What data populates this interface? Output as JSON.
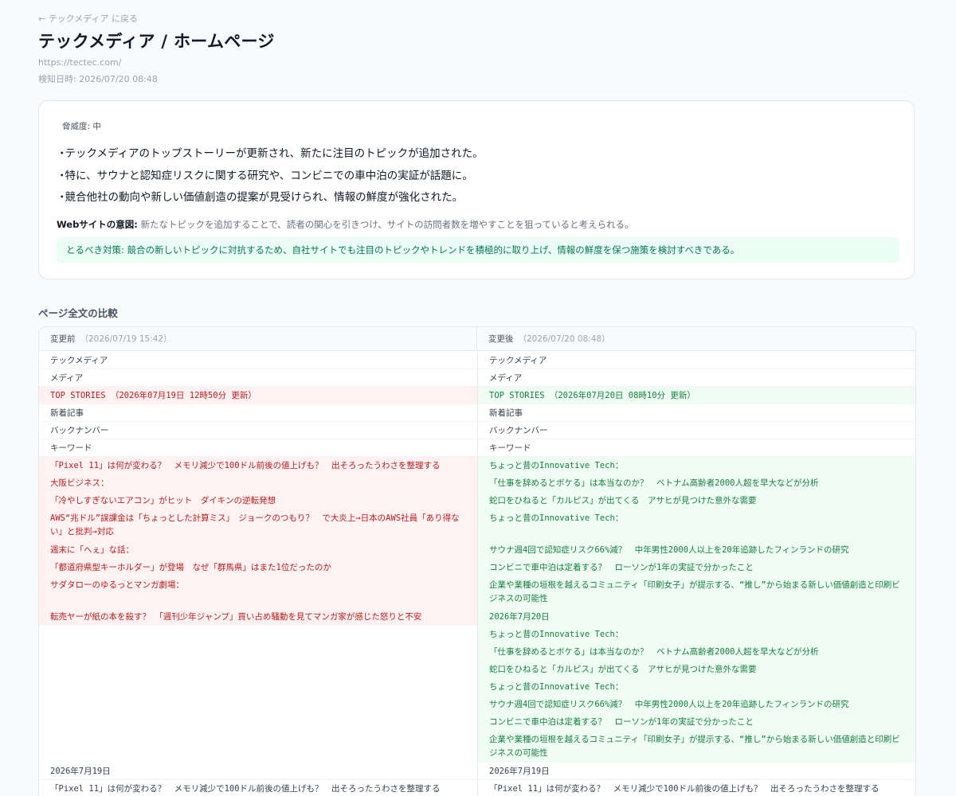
{
  "nav": {
    "back_label": "← テックメディア に戻る"
  },
  "header": {
    "title": "テックメディア / ホームページ",
    "url": "https://tectec.com/",
    "detected": "検知日時: 2026/07/20 08:48"
  },
  "summary": {
    "threat_level": "脅威度: 中",
    "bullets": [
      "テックメディアのトップストーリーが更新され、新たに注目のトピックが追加された。",
      "特に、サウナと認知症リスクに関する研究や、コンビニでの車中泊の実証が話題に。",
      "競合他社の動向や新しい価値創造の提案が見受けられ、情報の鮮度が強化された。"
    ],
    "intent_label": "Webサイトの意図:",
    "intent_text": "新たなトピックを追加することで、読者の関心を引きつけ、サイトの訪問者数を増やすことを狙っていると考えられる。",
    "action_text": "とるべき対策: 競合の新しいトピックに対抗するため、自社サイトでも注目のトピックやトレンドを積極的に取り上げ、情報の鮮度を保つ施策を検討すべきである。"
  },
  "comparison": {
    "section_title": "ページ全文の比較",
    "before_label": "変更前",
    "before_time": "（2026/07/19 15:42）",
    "after_label": "変更後",
    "after_time": "（2026/07/20 08:48）",
    "before_lines": [
      {
        "text": "テックメディア",
        "state": "same"
      },
      {
        "text": "メディア",
        "state": "same"
      },
      {
        "text": "TOP STORIES （2026年07月19日 12時50分 更新）",
        "state": "removed"
      },
      {
        "text": "新着記事",
        "state": "same"
      },
      {
        "text": "バックナンバー",
        "state": "same"
      },
      {
        "text": "キーワード",
        "state": "same"
      },
      {
        "text": "「Pixel 11」は何が変わる？　メモリ減少で100ドル前後の値上げも？　出そろったうわさを整理する",
        "state": "removed"
      },
      {
        "text": "大阪ビジネス：",
        "state": "removed"
      },
      {
        "text": "「冷やしすぎないエアコン」がヒット　ダイキンの逆転発想",
        "state": "removed"
      },
      {
        "text": "AWS“兆ドル”誤課金は「ちょっとした計算ミス」　ジョークのつもり？　で大炎上→日本のAWS社員「あり得ない」と批判→対応",
        "state": "removed"
      },
      {
        "text": "週末に「へぇ」な話：",
        "state": "removed"
      },
      {
        "text": "「都道府県型キーホルダー」が登場　なぜ「群馬県」はまた1位だったのか",
        "state": "removed"
      },
      {
        "text": "サダタローのゆるっとマンガ劇場：",
        "state": "removed"
      },
      {
        "text": "転売ヤーが紙の本を殺す？　「週刊少年ジャンプ」買い占め騒動を見てマンガ家が感じた怒りと不安",
        "state": "removed"
      },
      {
        "text": "2026年7月19日",
        "state": "same"
      },
      {
        "text": "「Pixel 11」は何が変わる？　メモリ減少で100ドル前後の値上げも？　出そろったうわさを整理する",
        "state": "same"
      }
    ],
    "after_lines": [
      {
        "text": "テックメディア",
        "state": "same"
      },
      {
        "text": "メディア",
        "state": "same"
      },
      {
        "text": "TOP STORIES （2026年07月20日 08時10分 更新）",
        "state": "added"
      },
      {
        "text": "新着記事",
        "state": "same"
      },
      {
        "text": "バックナンバー",
        "state": "same"
      },
      {
        "text": "キーワード",
        "state": "same"
      },
      {
        "text": "ちょっと昔のInnovative Tech：",
        "state": "added"
      },
      {
        "text": "「仕事を辞めるとボケる」は本当なのか？　ベトナム高齢者2000人超を早大などが分析",
        "state": "added"
      },
      {
        "text": "蛇口をひねると「カルピス」が出てくる　アサヒが見つけた意外な需要",
        "state": "added"
      },
      {
        "text": "ちょっと昔のInnovative Tech：",
        "state": "added"
      },
      {
        "text": "サウナ週4回で認知症リスク66%減？　中年男性2000人以上を20年追跡したフィンランドの研究",
        "state": "added"
      },
      {
        "text": "コンビニで車中泊は定着する？　ローソンが1年の実証で分かったこと",
        "state": "added"
      },
      {
        "text": "企業や業種の垣根を越えるコミュニティ「印刷女子」が提示する、“推し”から始まる新しい価値創造と印刷ビジネスの可能性",
        "state": "added"
      },
      {
        "text": "2026年7月20日",
        "state": "added"
      },
      {
        "text": "ちょっと昔のInnovative Tech：",
        "state": "added"
      },
      {
        "text": "「仕事を辞めるとボケる」は本当なのか？　ベトナム高齢者2000人超を早大などが分析",
        "state": "added"
      },
      {
        "text": "蛇口をひねると「カルピス」が出てくる　アサヒが見つけた意外な需要",
        "state": "added"
      },
      {
        "text": "ちょっと昔のInnovative Tech：",
        "state": "added"
      },
      {
        "text": "サウナ週4回で認知症リスク66%減？　中年男性2000人以上を20年追跡したフィンランドの研究",
        "state": "added"
      },
      {
        "text": "コンビニで車中泊は定着する？　ローソンが1年の実証で分かったこと",
        "state": "added"
      },
      {
        "text": "企業や業種の垣根を越えるコミュニティ「印刷女子」が提示する、“推し”から始まる新しい価値創造と印刷ビジネスの可能性",
        "state": "added"
      },
      {
        "text": "2026年7月19日",
        "state": "same"
      },
      {
        "text": "「Pixel 11」は何が変わる？　メモリ減少で100ドル前後の値上げも？　出そろったうわさを整理する",
        "state": "same"
      }
    ]
  }
}
